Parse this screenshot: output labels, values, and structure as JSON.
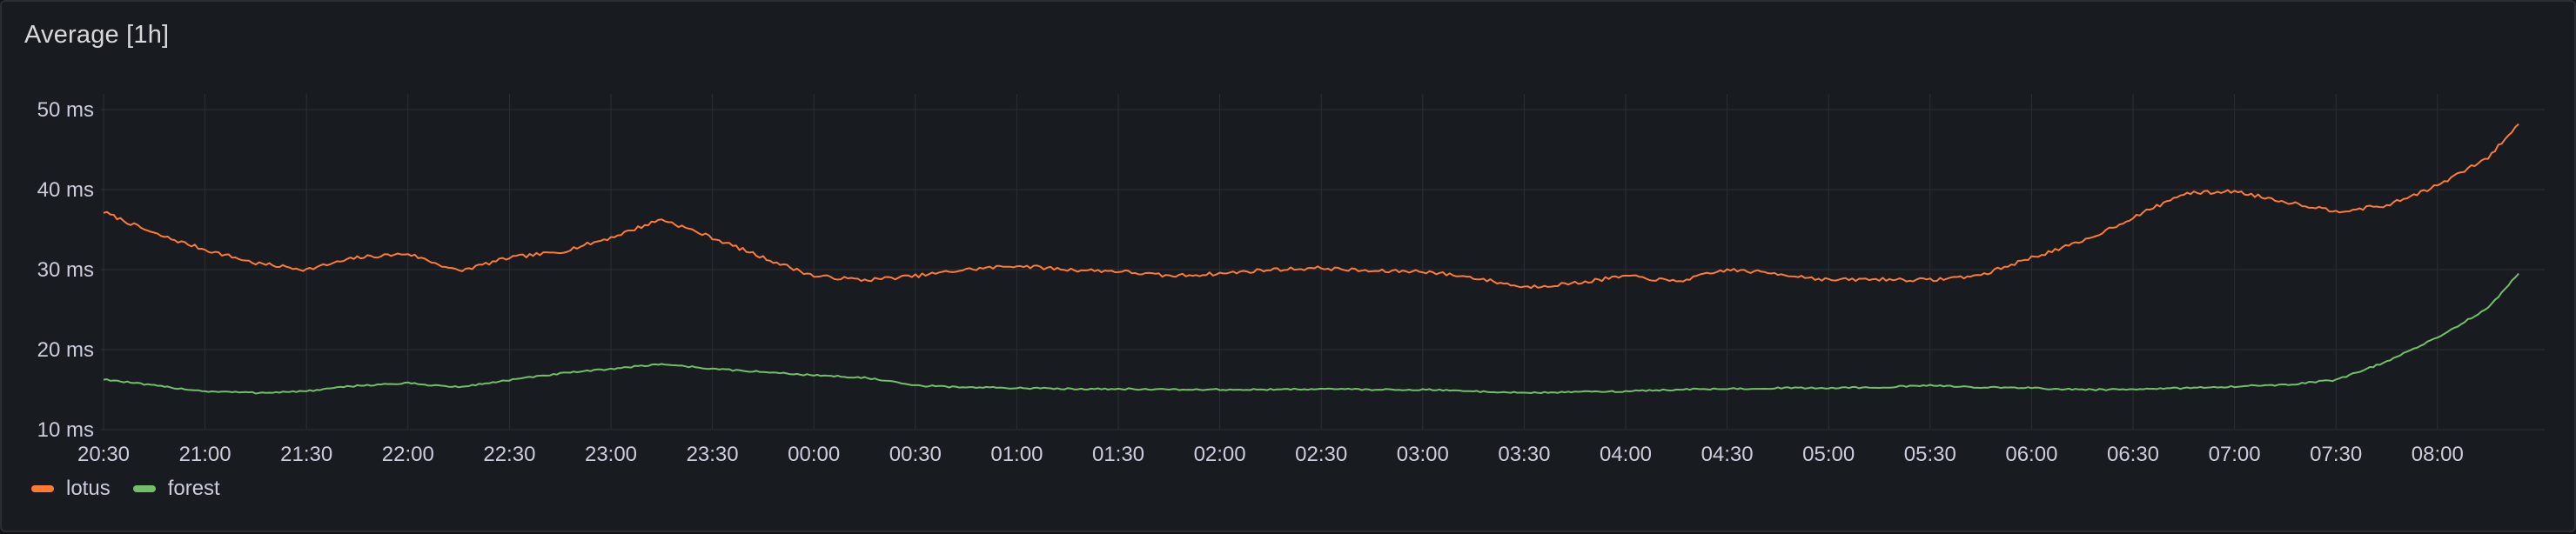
{
  "panel": {
    "title": "Average [1h]"
  },
  "colors": {
    "background": "#181b1f",
    "grid": "#2c2f35",
    "text": "#ccccdc"
  },
  "chart_data": {
    "type": "line",
    "title": "Average [1h]",
    "xlabel": "",
    "ylabel": "",
    "ylim": [
      10,
      50
    ],
    "y_ticks": [
      10,
      20,
      30,
      40,
      50
    ],
    "y_tick_labels": [
      "10 ms",
      "20 ms",
      "30 ms",
      "40 ms",
      "50 ms"
    ],
    "x_range": [
      "20:30",
      "08:24"
    ],
    "x_ticks": [
      "20:30",
      "21:00",
      "21:30",
      "22:00",
      "22:30",
      "23:00",
      "23:30",
      "00:00",
      "00:30",
      "01:00",
      "01:30",
      "02:00",
      "02:30",
      "03:00",
      "03:30",
      "04:00",
      "04:30",
      "05:00",
      "05:30",
      "06:00",
      "06:30",
      "07:00",
      "07:30",
      "08:00"
    ],
    "grid": true,
    "legend_position": "bottom-left",
    "series": [
      {
        "name": "lotus",
        "color": "#ff7a35",
        "x": [
          "20:30",
          "20:45",
          "21:00",
          "21:15",
          "21:30",
          "21:45",
          "22:00",
          "22:15",
          "22:30",
          "22:45",
          "23:00",
          "23:15",
          "23:30",
          "23:45",
          "00:00",
          "00:15",
          "00:30",
          "00:45",
          "01:00",
          "01:15",
          "01:30",
          "01:45",
          "02:00",
          "02:15",
          "02:30",
          "02:45",
          "03:00",
          "03:15",
          "03:30",
          "03:45",
          "04:00",
          "04:15",
          "04:30",
          "04:45",
          "05:00",
          "05:15",
          "05:30",
          "05:45",
          "06:00",
          "06:15",
          "06:30",
          "06:45",
          "07:00",
          "07:15",
          "07:30",
          "07:45",
          "08:00",
          "08:15",
          "08:24"
        ],
        "values": [
          37.2,
          34.5,
          32.5,
          30.8,
          30.0,
          31.5,
          32.0,
          29.8,
          31.5,
          32.2,
          34.0,
          36.3,
          34.0,
          31.5,
          29.2,
          28.7,
          29.2,
          30.0,
          30.5,
          30.0,
          29.8,
          29.2,
          29.5,
          30.0,
          30.2,
          29.8,
          29.8,
          29.0,
          27.8,
          28.3,
          29.2,
          28.5,
          30.0,
          29.5,
          28.7,
          28.8,
          28.7,
          29.3,
          31.5,
          33.5,
          36.5,
          39.5,
          39.8,
          38.5,
          37.3,
          38.0,
          40.5,
          44.0,
          48.2
        ]
      },
      {
        "name": "forest",
        "color": "#73bf69",
        "x": [
          "20:30",
          "20:45",
          "21:00",
          "21:15",
          "21:30",
          "21:45",
          "22:00",
          "22:15",
          "22:30",
          "22:45",
          "23:00",
          "23:15",
          "23:30",
          "23:45",
          "00:00",
          "00:15",
          "00:30",
          "00:45",
          "01:00",
          "01:15",
          "01:30",
          "01:45",
          "02:00",
          "02:15",
          "02:30",
          "02:45",
          "03:00",
          "03:15",
          "03:30",
          "03:45",
          "04:00",
          "04:15",
          "04:30",
          "04:45",
          "05:00",
          "05:15",
          "05:30",
          "05:45",
          "06:00",
          "06:15",
          "06:30",
          "06:45",
          "07:00",
          "07:15",
          "07:30",
          "07:45",
          "08:00",
          "08:15",
          "08:24"
        ],
        "values": [
          16.3,
          15.5,
          14.8,
          14.6,
          14.8,
          15.5,
          15.8,
          15.3,
          16.2,
          17.0,
          17.6,
          18.2,
          17.6,
          17.2,
          16.8,
          16.5,
          15.5,
          15.3,
          15.2,
          15.1,
          15.1,
          15.0,
          15.0,
          15.0,
          15.1,
          15.0,
          15.0,
          14.8,
          14.6,
          14.7,
          14.8,
          15.0,
          15.1,
          15.2,
          15.2,
          15.3,
          15.5,
          15.3,
          15.2,
          15.0,
          15.0,
          15.2,
          15.4,
          15.6,
          16.2,
          18.5,
          21.5,
          25.2,
          29.5
        ]
      }
    ]
  }
}
